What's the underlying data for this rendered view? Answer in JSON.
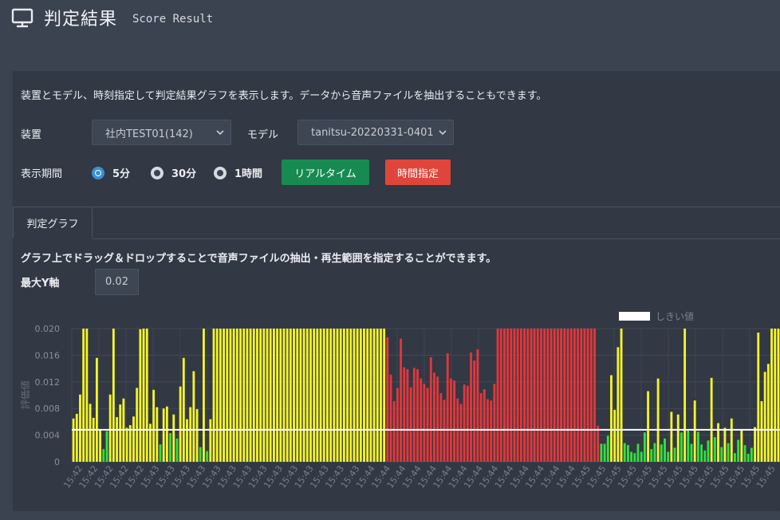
{
  "header": {
    "title": "判定結果",
    "subtitle": "Score Result",
    "icon": "monitor-icon"
  },
  "panel": {
    "description": "装置とモデル、時刻指定して判定結果グラフを表示します。データから音声ファイルを抽出することもできます。"
  },
  "form": {
    "device_label": "装置",
    "device_value": "社内TEST01(142)",
    "model_label": "モデル",
    "model_value": "tanitsu-20220331-0401",
    "period_label": "表示期間",
    "period_options": [
      {
        "label": "5分",
        "selected": true
      },
      {
        "label": "30分",
        "selected": false
      },
      {
        "label": "1時間",
        "selected": false
      }
    ],
    "realtime_button": "リアルタイム",
    "time_button": "時間指定"
  },
  "tabs": [
    {
      "label": "判定グラフ",
      "active": true
    }
  ],
  "graph": {
    "description": "グラフ上でドラッグ＆ドロップすることで音声ファイルの抽出・再生範囲を指定することができます。",
    "ymax_label": "最大Y軸",
    "ymax_value": "0.02"
  },
  "colors": {
    "green": "#34e03f",
    "yellow": "#f4f42a",
    "red": "#e3373a",
    "threshold": "#ffffff",
    "button_green": "#178a52",
    "button_red": "#e0453b"
  },
  "chart_data": {
    "type": "bar",
    "ylabel": "評価値",
    "ylim": [
      0,
      0.02
    ],
    "yticks": [
      "0",
      "0.004",
      "0.008",
      "0.012",
      "0.016",
      "0.020"
    ],
    "threshold": 0.0048,
    "legend": [
      {
        "name": "しきい値",
        "color": "#ffffff"
      }
    ],
    "legend_position": "top-right",
    "grid": true,
    "x_labels": [
      "15:42",
      "15:42",
      "15:42",
      "15:42",
      "15:42",
      "15:43",
      "15:43",
      "15:43",
      "15:43",
      "15:43",
      "15:43",
      "15:43",
      "15:43",
      "15:43",
      "15:43",
      "15:43",
      "15:43",
      "15:43",
      "15:43",
      "15:44",
      "15:44",
      "15:44",
      "15:44",
      "15:44",
      "15:44",
      "15:44",
      "15:44",
      "15:44",
      "15:44",
      "15:44",
      "15:44",
      "15:44",
      "15:44",
      "15:45",
      "15:45",
      "15:45",
      "15:45",
      "15:45",
      "15:45",
      "15:45",
      "15:45",
      "15:45",
      "15:45",
      "15:45",
      "15:45",
      "15:45"
    ],
    "values": [
      0.0065,
      0.0072,
      0.0101,
      0.02,
      0.02,
      0.0087,
      0.0066,
      0.0156,
      0.0048,
      0.0019,
      0.0046,
      0.0101,
      0.02,
      0.0067,
      0.0086,
      0.0095,
      0.0051,
      0.0055,
      0.0068,
      0.0111,
      0.0199,
      0.02,
      0.02,
      0.0057,
      0.0108,
      0.0082,
      0.0026,
      0.008,
      0.0083,
      0.0043,
      0.0071,
      0.0035,
      0.0113,
      0.0156,
      0.0064,
      0.0082,
      0.0136,
      0.0079,
      0.0022,
      0.02,
      0.0016,
      0.0064,
      0.02,
      0.02,
      0.02,
      0.02,
      0.02,
      0.02,
      0.02,
      0.02,
      0.02,
      0.02,
      0.02,
      0.02,
      0.02,
      0.02,
      0.02,
      0.02,
      0.02,
      0.02,
      0.02,
      0.02,
      0.02,
      0.02,
      0.02,
      0.02,
      0.02,
      0.02,
      0.02,
      0.02,
      0.02,
      0.02,
      0.02,
      0.02,
      0.02,
      0.02,
      0.02,
      0.02,
      0.02,
      0.02,
      0.02,
      0.02,
      0.02,
      0.02,
      0.02,
      0.02,
      0.02,
      0.02,
      0.02,
      0.02,
      0.02,
      0.02,
      0.02,
      0.02,
      0.0187,
      0.0131,
      0.0091,
      0.0111,
      0.0185,
      0.0142,
      0.0139,
      0.0112,
      0.0141,
      0.0139,
      0.0125,
      0.0117,
      0.0111,
      0.0157,
      0.0134,
      0.0128,
      0.0103,
      0.0093,
      0.0163,
      0.0125,
      0.0122,
      0.0095,
      0.0087,
      0.0116,
      0.0114,
      0.0164,
      0.0152,
      0.0169,
      0.0103,
      0.0109,
      0.0094,
      0.0092,
      0.0117,
      0.02,
      0.02,
      0.02,
      0.02,
      0.02,
      0.02,
      0.02,
      0.02,
      0.02,
      0.02,
      0.02,
      0.02,
      0.02,
      0.02,
      0.02,
      0.02,
      0.02,
      0.02,
      0.02,
      0.02,
      0.02,
      0.02,
      0.02,
      0.02,
      0.02,
      0.02,
      0.02,
      0.02,
      0.02,
      0.02,
      0.0054,
      0.0027,
      0.0027,
      0.0039,
      0.013,
      0.0078,
      0.0172,
      0.02,
      0.0028,
      0.0025,
      0.0015,
      0.0013,
      0.0027,
      0.0015,
      0.0044,
      0.0106,
      0.0019,
      0.0028,
      0.0125,
      0.0026,
      0.0035,
      0.0015,
      0.0075,
      0.0021,
      0.0071,
      0.0044,
      0.02,
      0.0047,
      0.0027,
      0.0092,
      0.0045,
      0.0026,
      0.0017,
      0.0032,
      0.0126,
      0.0037,
      0.0058,
      0.0022,
      0.0051,
      0.0028,
      0.0065,
      0.0013,
      0.0033,
      0.0048,
      0.0025,
      0.0012,
      0.0021,
      0.0052,
      0.0194,
      0.0091,
      0.0135,
      0.0147,
      0.02,
      0.02,
      0.02
    ]
  }
}
